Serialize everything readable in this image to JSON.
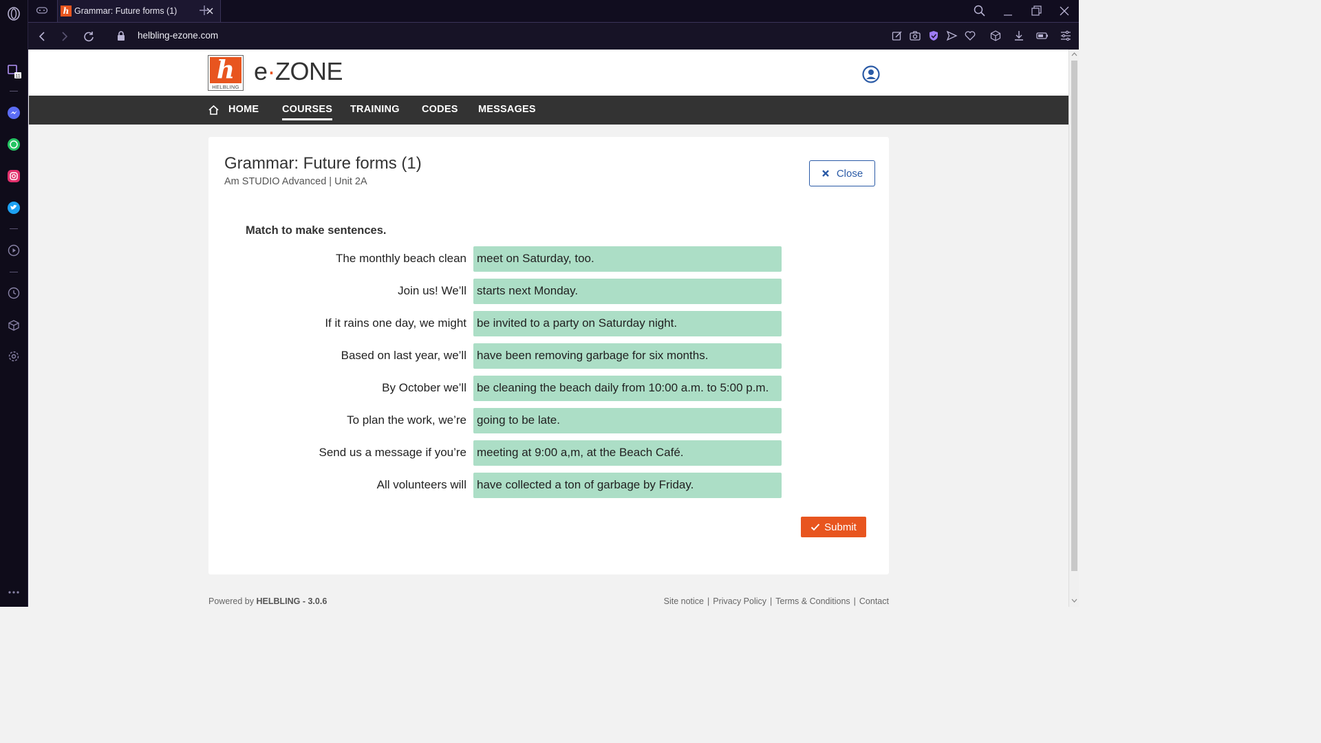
{
  "browser": {
    "tab_title": "Grammar: Future forms (1)",
    "url": "helbling-ezone.com",
    "sidebar_badge": "11"
  },
  "site": {
    "logo_caption": "HELBLING",
    "brand_e": "e",
    "brand_dot": "·",
    "brand_zone": "ZONE",
    "nav": {
      "home": "HOME",
      "courses": "COURSES",
      "training": "TRAINING",
      "codes": "CODES",
      "messages": "MESSAGES"
    }
  },
  "exercise": {
    "title": "Grammar: Future forms (1)",
    "subtitle": "Am STUDIO Advanced | Unit 2A",
    "close_label": "Close",
    "instruction": "Match to make sentences.",
    "rows": [
      {
        "prompt": "The monthly beach clean",
        "answer": "meet on Saturday, too."
      },
      {
        "prompt": "Join us! We’ll",
        "answer": "starts next Monday."
      },
      {
        "prompt": "If it rains one day, we might",
        "answer": "be invited to a party on Saturday night."
      },
      {
        "prompt": "Based on last year, we’ll",
        "answer": "have been removing garbage for six months."
      },
      {
        "prompt": "By October we’ll",
        "answer": "be cleaning the beach daily from 10:00 a.m. to 5:00 p.m."
      },
      {
        "prompt": "To plan the work, we’re",
        "answer": "going to be late."
      },
      {
        "prompt": "Send us a message if you’re",
        "answer": "meeting at 9:00 a,m, at the Beach Café."
      },
      {
        "prompt": "All volunteers will",
        "answer": "have collected a ton of garbage by Friday."
      }
    ],
    "submit_label": "Submit"
  },
  "footer": {
    "powered_prefix": "Powered by ",
    "powered_brand": "HELBLING - 3.0.6",
    "links": [
      "Site notice",
      "Privacy Policy",
      "Terms & Conditions",
      "Contact"
    ]
  },
  "colors": {
    "accent_orange": "#e8551f",
    "answer_green": "#acdec6",
    "close_blue": "#2a5aa6",
    "nav_dark": "#333333"
  }
}
